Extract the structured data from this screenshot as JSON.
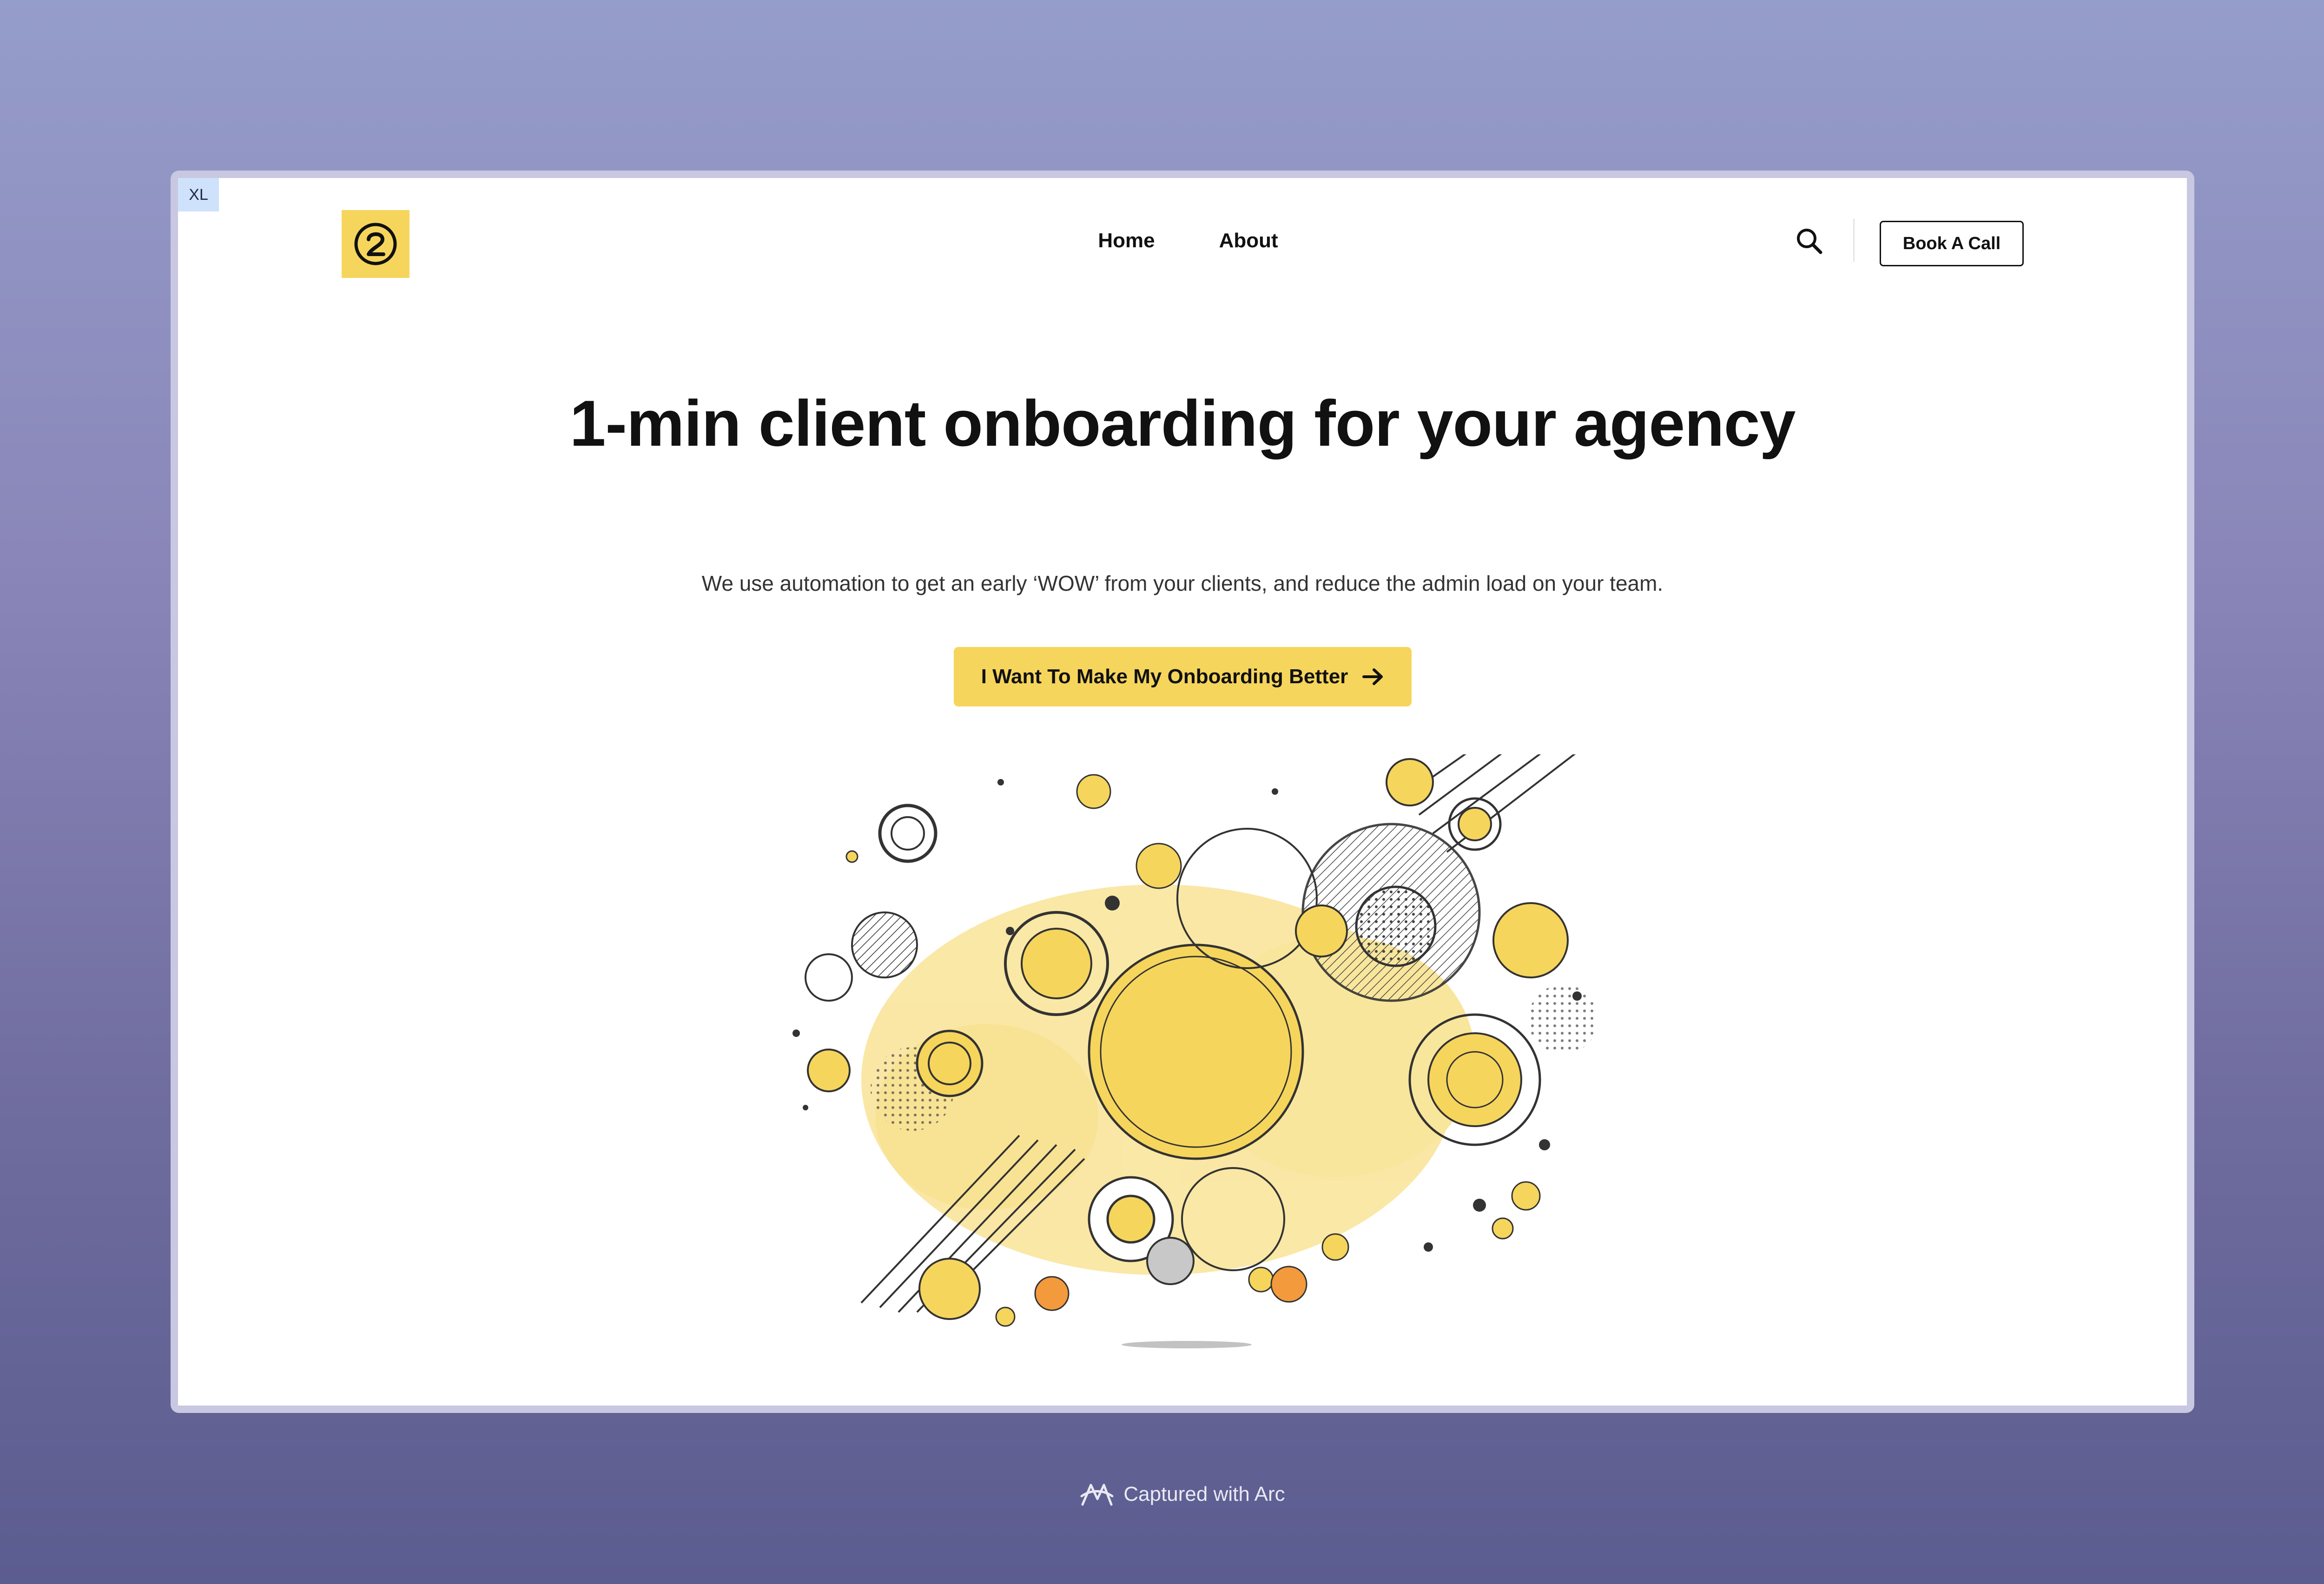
{
  "breakpoint_badge": "XL",
  "logo": {
    "glyph": "②",
    "background": "#f6d55c"
  },
  "nav": [
    {
      "label": "Home"
    },
    {
      "label": "About"
    }
  ],
  "header": {
    "book_call_label": "Book A Call"
  },
  "hero": {
    "title": "1-min client onboarding for your agency",
    "subtitle": "We use automation to get an early ‘WOW’ from your clients, and reduce the admin load on your team.",
    "cta_label": "I Want To Make My Onboarding Better",
    "cta_color": "#f6d55c"
  },
  "footer": {
    "captured_label": "Captured with Arc"
  },
  "icons": [
    "search-icon",
    "arrow-right-icon",
    "arc-logo-icon"
  ]
}
